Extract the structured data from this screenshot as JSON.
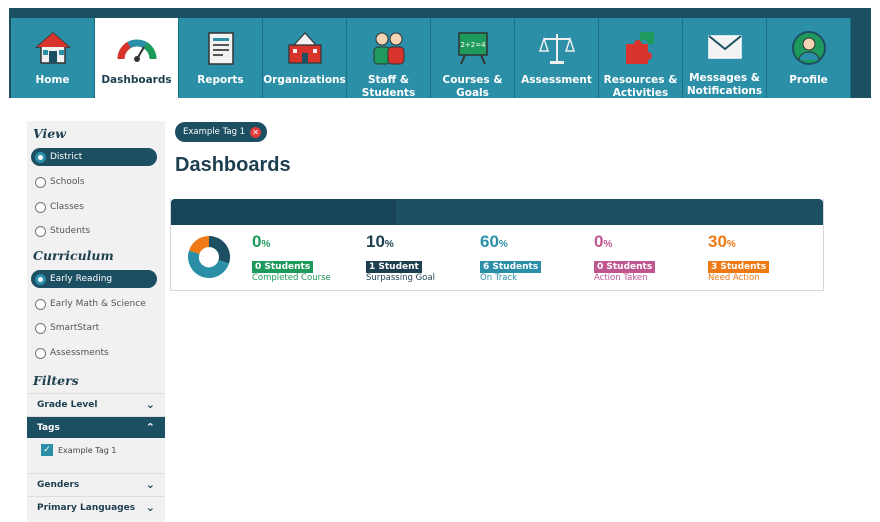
{
  "nav": {
    "items": [
      {
        "label": "Home",
        "icon": "home-icon"
      },
      {
        "label": "Dashboards",
        "icon": "gauge-icon",
        "active": true
      },
      {
        "label": "Reports",
        "icon": "report-icon"
      },
      {
        "label": "Organizations",
        "icon": "school-building-icon"
      },
      {
        "label": "Staff & Students",
        "icon": "people-icon"
      },
      {
        "label": "Courses & Goals",
        "icon": "easel-icon"
      },
      {
        "label": "Assessment",
        "icon": "scale-icon"
      },
      {
        "label": "Resources & Activities",
        "icon": "puzzle-icon"
      },
      {
        "label": "Messages & Notifications",
        "icon": "envelope-icon"
      },
      {
        "label": "Profile",
        "icon": "user-icon"
      }
    ]
  },
  "sidebar": {
    "view_title": "View",
    "view_options": [
      {
        "label": "District",
        "selected": true
      },
      {
        "label": "Schools",
        "selected": false
      },
      {
        "label": "Classes",
        "selected": false
      },
      {
        "label": "Students",
        "selected": false
      }
    ],
    "curriculum_title": "Curriculum",
    "curriculum_options": [
      {
        "label": "Early Reading",
        "selected": true
      },
      {
        "label": "Early Math & Science",
        "selected": false
      },
      {
        "label": "SmartStart",
        "selected": false
      },
      {
        "label": "Assessments",
        "selected": false
      }
    ],
    "filters_title": "Filters",
    "filters": [
      {
        "label": "Grade Level",
        "open": false
      },
      {
        "label": "Tags",
        "open": true
      },
      {
        "label": "Genders",
        "open": false
      },
      {
        "label": "Primary Languages",
        "open": false
      }
    ],
    "tag_options": [
      {
        "label": "Example Tag 1",
        "checked": true
      }
    ]
  },
  "main": {
    "active_tag": "Example Tag 1",
    "page_title": "Dashboards",
    "stats": [
      {
        "value": "0",
        "unit": "%",
        "badge": "0 Students",
        "caption": "Completed Course",
        "color": "#1e9a5c"
      },
      {
        "value": "10",
        "unit": "%",
        "badge": "1 Student",
        "caption": "Surpassing Goal",
        "color": "#1d3f4f"
      },
      {
        "value": "60",
        "unit": "%",
        "badge": "6 Students",
        "caption": "On Track",
        "color": "#2b8fa8"
      },
      {
        "value": "0",
        "unit": "%",
        "badge": "0 Students",
        "caption": "Action Taken",
        "color": "#c0568f"
      },
      {
        "value": "30",
        "unit": "%",
        "badge": "3 Students",
        "caption": "Need Action",
        "color": "#ee7a16"
      }
    ]
  },
  "colors": {
    "nav_bg": "#2b8fa8",
    "header_dark": "#1d4f62",
    "title": "#1d3f4f"
  }
}
